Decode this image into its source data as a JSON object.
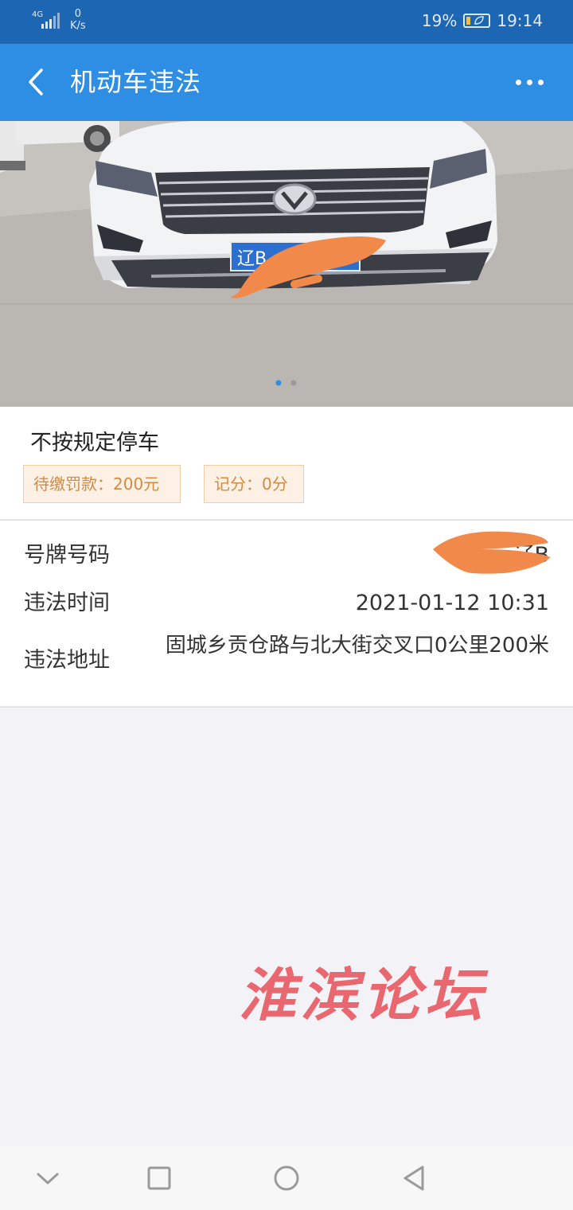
{
  "status_bar": {
    "network": "4G",
    "speed_value": "0",
    "speed_unit": "K/s",
    "battery": "19%",
    "time": "19:14"
  },
  "header": {
    "title": "机动车违法"
  },
  "carousel": {
    "plate_visible": "辽B",
    "page_count": 2,
    "active_page": 1
  },
  "violation": {
    "type": "不按规定停车",
    "fine_tag": "待缴罚款：200元",
    "points_tag": "记分：0分"
  },
  "details": {
    "plate_label": "号牌号码",
    "plate_value": "辽B",
    "time_label": "违法时间",
    "time_value": "2021-01-12 10:31",
    "address_label": "违法地址",
    "address_value": "固城乡贡仓路与北大街交叉口0公里200米"
  },
  "watermark": {
    "text": "淮滨论坛"
  },
  "colors": {
    "status_bar": "#1d66b4",
    "header": "#2e8ee4",
    "tag_text": "#d58a3f",
    "tag_bg": "#fdf0e4",
    "watermark": "#e9676f",
    "scribble": "#f0894a"
  },
  "icons": {
    "back": "chevron-left-icon",
    "more": "more-horizontal-icon",
    "nav_hide": "chevron-down-icon",
    "nav_recent": "square-icon",
    "nav_home": "circle-icon",
    "nav_back": "triangle-left-icon"
  }
}
